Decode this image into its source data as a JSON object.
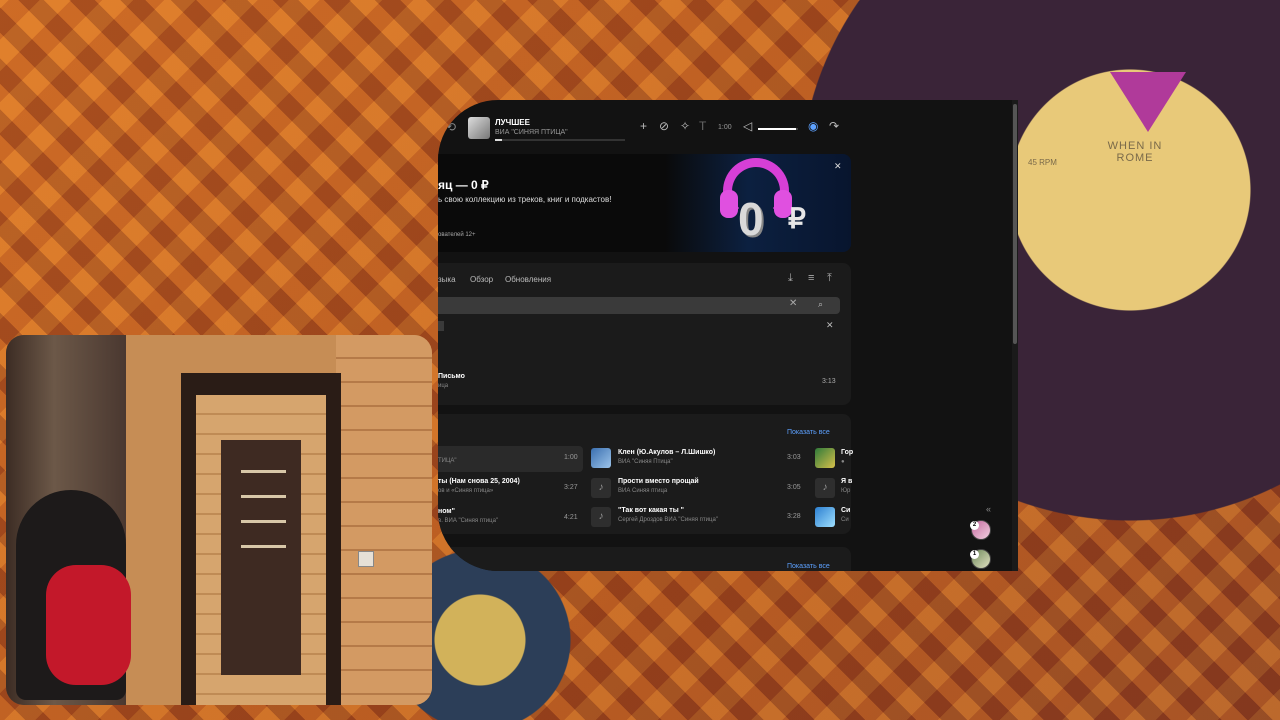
{
  "background": {
    "record_label": "WHEN IN ROME",
    "record_rpm": "45 RPM"
  },
  "player": {
    "title": "ЛУЧШЕЕ",
    "artist": "ВИА \"СИНЯЯ ПТИЦА\"",
    "progress": 0.05,
    "time": "1:00",
    "volume": 0.95,
    "icons": [
      "back-icon",
      "add-icon",
      "dislike-icon",
      "sparkle-icon",
      "text-icon",
      "volume-icon",
      "broadcast-icon",
      "share-icon"
    ]
  },
  "banner": {
    "title": "яц — 0 ₽",
    "subtitle": "ь свою коллекцию из треков, книг и подкастов!",
    "age_note": "ователей 12+",
    "zero": "0",
    "currency": "₽"
  },
  "collection": {
    "tabs": [
      "зыка",
      "Обзор",
      "Обновления"
    ],
    "result": {
      "title": "Письмо",
      "subtitle": "ица",
      "duration": "3:13"
    }
  },
  "tracks": {
    "show_all": "Показать все",
    "show_all_2": "Показать все",
    "col1": [
      {
        "title": "",
        "subtitle": "ТИЦА\"",
        "duration": "1:00"
      },
      {
        "title": "ты (Нам снова 25, 2004)",
        "subtitle": "ов и «Синяя птица»",
        "duration": "3:27"
      },
      {
        "title": "ном\"",
        "subtitle": "в. ВИА \"Синяя птица\"",
        "duration": "4:21"
      }
    ],
    "col2": [
      {
        "title": "Клен (Ю.Акулов – Л.Шишко)",
        "subtitle": "ВИА \"Синяя Птица\"",
        "duration": "3:03"
      },
      {
        "title": "Прости вместо прощай",
        "subtitle": "ВИА Синяя птица",
        "duration": "3:05"
      },
      {
        "title": "\"Так вот какая ты \"",
        "subtitle": "Сергей Дроздов ВИА \"Синяя птица\"",
        "duration": "3:28"
      }
    ],
    "col3": [
      {
        "title": "Гор",
        "subtitle": "●"
      },
      {
        "title": "Я в",
        "subtitle": "Юр"
      },
      {
        "title": "Си",
        "subtitle": "Си"
      }
    ]
  },
  "sidebar": {
    "badges": [
      "2",
      "1"
    ]
  }
}
